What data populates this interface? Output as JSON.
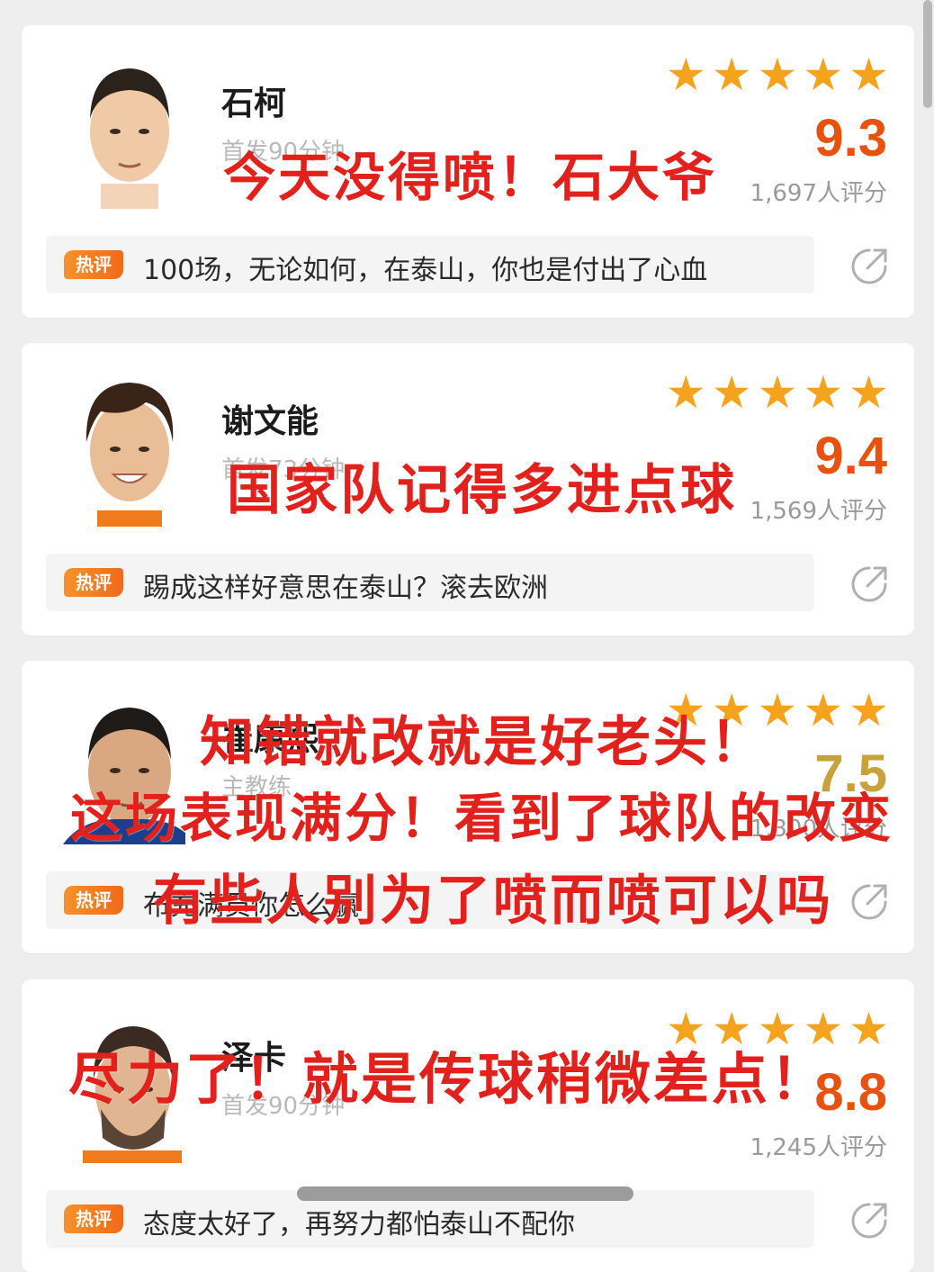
{
  "players": [
    {
      "name": "石柯",
      "role": "首发90分钟",
      "score": "9.3",
      "rating_count": "1,697人评分",
      "stars": 5,
      "hot_badge": "热评",
      "hot_comment": "100场，无论如何，在泰山，你也是付出了心血"
    },
    {
      "name": "谢文能",
      "role": "首发73分钟",
      "score": "9.4",
      "rating_count": "1,569人评分",
      "stars": 5,
      "hot_badge": "热评",
      "hot_comment": "踢成这样好意思在泰山？滚去欧洲"
    },
    {
      "name": "崔康熙",
      "role": "主教练",
      "score": "7.5",
      "rating_count": "1,300人评分",
      "stars": 5,
      "hot_badge": "热评",
      "hot_comment": "布充满员你怎么赢"
    },
    {
      "name": "泽卡",
      "role": "首发90分钟",
      "score": "8.8",
      "rating_count": "1,245人评分",
      "stars": 5,
      "hot_badge": "热评",
      "hot_comment": "态度太好了，再努力都怕泰山不配你"
    }
  ],
  "overlays": {
    "o1": "今天没得喷！石大爷",
    "o2": "国家队记得多进点球",
    "o3": "知错就改就是好老头！",
    "o4": "这场表现满分！看到了球队的改变",
    "o5": "有些人别为了喷而喷可以吗",
    "o6": "尽力了！就是传球稍微差点！"
  },
  "colors": {
    "star": "#f5a21c",
    "score": "#e8520e",
    "overlay": "#e2211c",
    "badge": "#f06a1a"
  }
}
